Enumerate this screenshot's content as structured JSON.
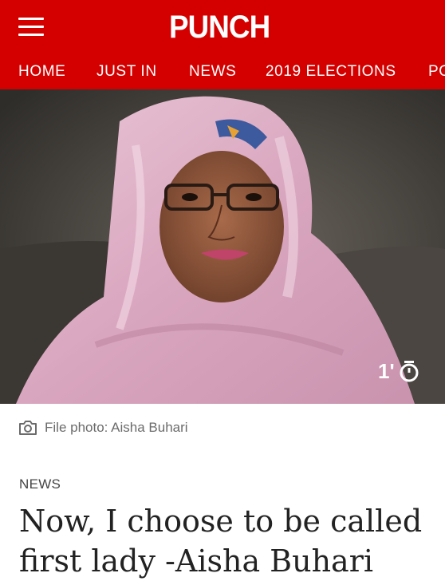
{
  "header": {
    "logo": "PUNCH",
    "menu_icon": "hamburger-menu-icon",
    "nav": [
      "HOME",
      "JUST IN",
      "NEWS",
      "2019 ELECTIONS",
      "PO"
    ]
  },
  "hero": {
    "timer_label": "1'",
    "timer_icon": "stopwatch-icon"
  },
  "caption": {
    "icon": "camera-icon",
    "text": "File photo: Aisha Buhari"
  },
  "article": {
    "category": "NEWS",
    "headline": "Now, I choose to be called first lady -Aisha Buhari"
  },
  "colors": {
    "brand": "#d40000",
    "text": "#222222",
    "muted": "#6b6b6b"
  }
}
